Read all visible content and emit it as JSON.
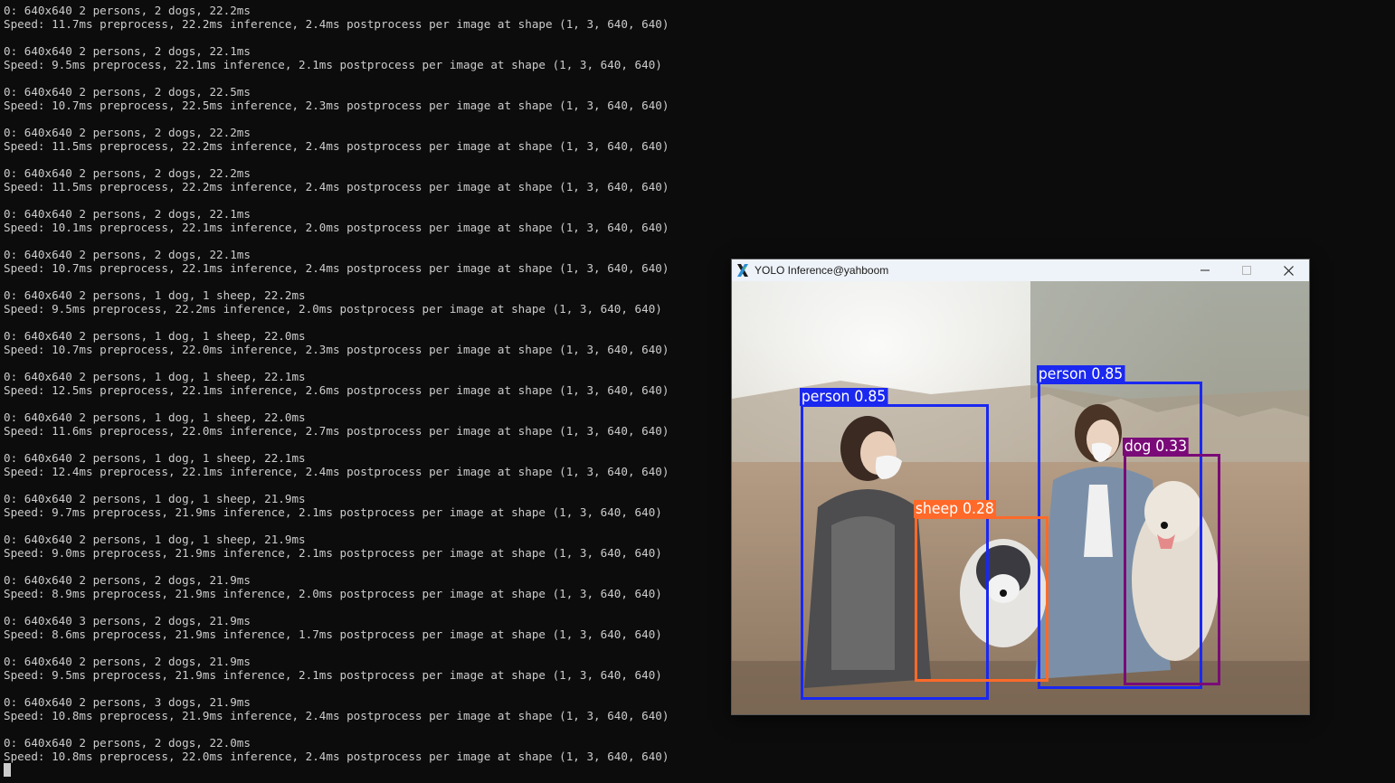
{
  "terminal": {
    "lines": [
      "0: 640x640 2 persons, 2 dogs, 22.2ms",
      "Speed: 11.7ms preprocess, 22.2ms inference, 2.4ms postprocess per image at shape (1, 3, 640, 640)",
      "",
      "0: 640x640 2 persons, 2 dogs, 22.1ms",
      "Speed: 9.5ms preprocess, 22.1ms inference, 2.1ms postprocess per image at shape (1, 3, 640, 640)",
      "",
      "0: 640x640 2 persons, 2 dogs, 22.5ms",
      "Speed: 10.7ms preprocess, 22.5ms inference, 2.3ms postprocess per image at shape (1, 3, 640, 640)",
      "",
      "0: 640x640 2 persons, 2 dogs, 22.2ms",
      "Speed: 11.5ms preprocess, 22.2ms inference, 2.4ms postprocess per image at shape (1, 3, 640, 640)",
      "",
      "0: 640x640 2 persons, 2 dogs, 22.2ms",
      "Speed: 11.5ms preprocess, 22.2ms inference, 2.4ms postprocess per image at shape (1, 3, 640, 640)",
      "",
      "0: 640x640 2 persons, 2 dogs, 22.1ms",
      "Speed: 10.1ms preprocess, 22.1ms inference, 2.0ms postprocess per image at shape (1, 3, 640, 640)",
      "",
      "0: 640x640 2 persons, 2 dogs, 22.1ms",
      "Speed: 10.7ms preprocess, 22.1ms inference, 2.4ms postprocess per image at shape (1, 3, 640, 640)",
      "",
      "0: 640x640 2 persons, 1 dog, 1 sheep, 22.2ms",
      "Speed: 9.5ms preprocess, 22.2ms inference, 2.0ms postprocess per image at shape (1, 3, 640, 640)",
      "",
      "0: 640x640 2 persons, 1 dog, 1 sheep, 22.0ms",
      "Speed: 10.7ms preprocess, 22.0ms inference, 2.3ms postprocess per image at shape (1, 3, 640, 640)",
      "",
      "0: 640x640 2 persons, 1 dog, 1 sheep, 22.1ms",
      "Speed: 12.5ms preprocess, 22.1ms inference, 2.6ms postprocess per image at shape (1, 3, 640, 640)",
      "",
      "0: 640x640 2 persons, 1 dog, 1 sheep, 22.0ms",
      "Speed: 11.6ms preprocess, 22.0ms inference, 2.7ms postprocess per image at shape (1, 3, 640, 640)",
      "",
      "0: 640x640 2 persons, 1 dog, 1 sheep, 22.1ms",
      "Speed: 12.4ms preprocess, 22.1ms inference, 2.4ms postprocess per image at shape (1, 3, 640, 640)",
      "",
      "0: 640x640 2 persons, 1 dog, 1 sheep, 21.9ms",
      "Speed: 9.7ms preprocess, 21.9ms inference, 2.1ms postprocess per image at shape (1, 3, 640, 640)",
      "",
      "0: 640x640 2 persons, 1 dog, 1 sheep, 21.9ms",
      "Speed: 9.0ms preprocess, 21.9ms inference, 2.1ms postprocess per image at shape (1, 3, 640, 640)",
      "",
      "0: 640x640 2 persons, 2 dogs, 21.9ms",
      "Speed: 8.9ms preprocess, 21.9ms inference, 2.0ms postprocess per image at shape (1, 3, 640, 640)",
      "",
      "0: 640x640 3 persons, 2 dogs, 21.9ms",
      "Speed: 8.6ms preprocess, 21.9ms inference, 1.7ms postprocess per image at shape (1, 3, 640, 640)",
      "",
      "0: 640x640 2 persons, 2 dogs, 21.9ms",
      "Speed: 9.5ms preprocess, 21.9ms inference, 2.1ms postprocess per image at shape (1, 3, 640, 640)",
      "",
      "0: 640x640 2 persons, 3 dogs, 21.9ms",
      "Speed: 10.8ms preprocess, 21.9ms inference, 2.4ms postprocess per image at shape (1, 3, 640, 640)",
      "",
      "0: 640x640 2 persons, 2 dogs, 22.0ms",
      "Speed: 10.8ms preprocess, 22.0ms inference, 2.4ms postprocess per image at shape (1, 3, 640, 640)"
    ]
  },
  "window": {
    "title": "YOLO Inference@yahboom",
    "app_icon": "x-app-icon",
    "controls": {
      "minimize_icon": "minimize-icon",
      "maximize_icon": "maximize-icon",
      "close_icon": "close-icon"
    }
  },
  "detections": [
    {
      "class": "person",
      "label": "person 0.85",
      "color": "#1a28f0"
    },
    {
      "class": "person",
      "label": "person 0.85",
      "color": "#1a28f0"
    },
    {
      "class": "sheep",
      "label": "sheep 0.28",
      "color": "#ff6a2a"
    },
    {
      "class": "dog",
      "label": "dog 0.33",
      "color": "#7a0a78"
    }
  ],
  "colors": {
    "terminal_bg": "#0c0c0c",
    "terminal_fg": "#cccccc",
    "titlebar_bg": "#eef3f9"
  }
}
